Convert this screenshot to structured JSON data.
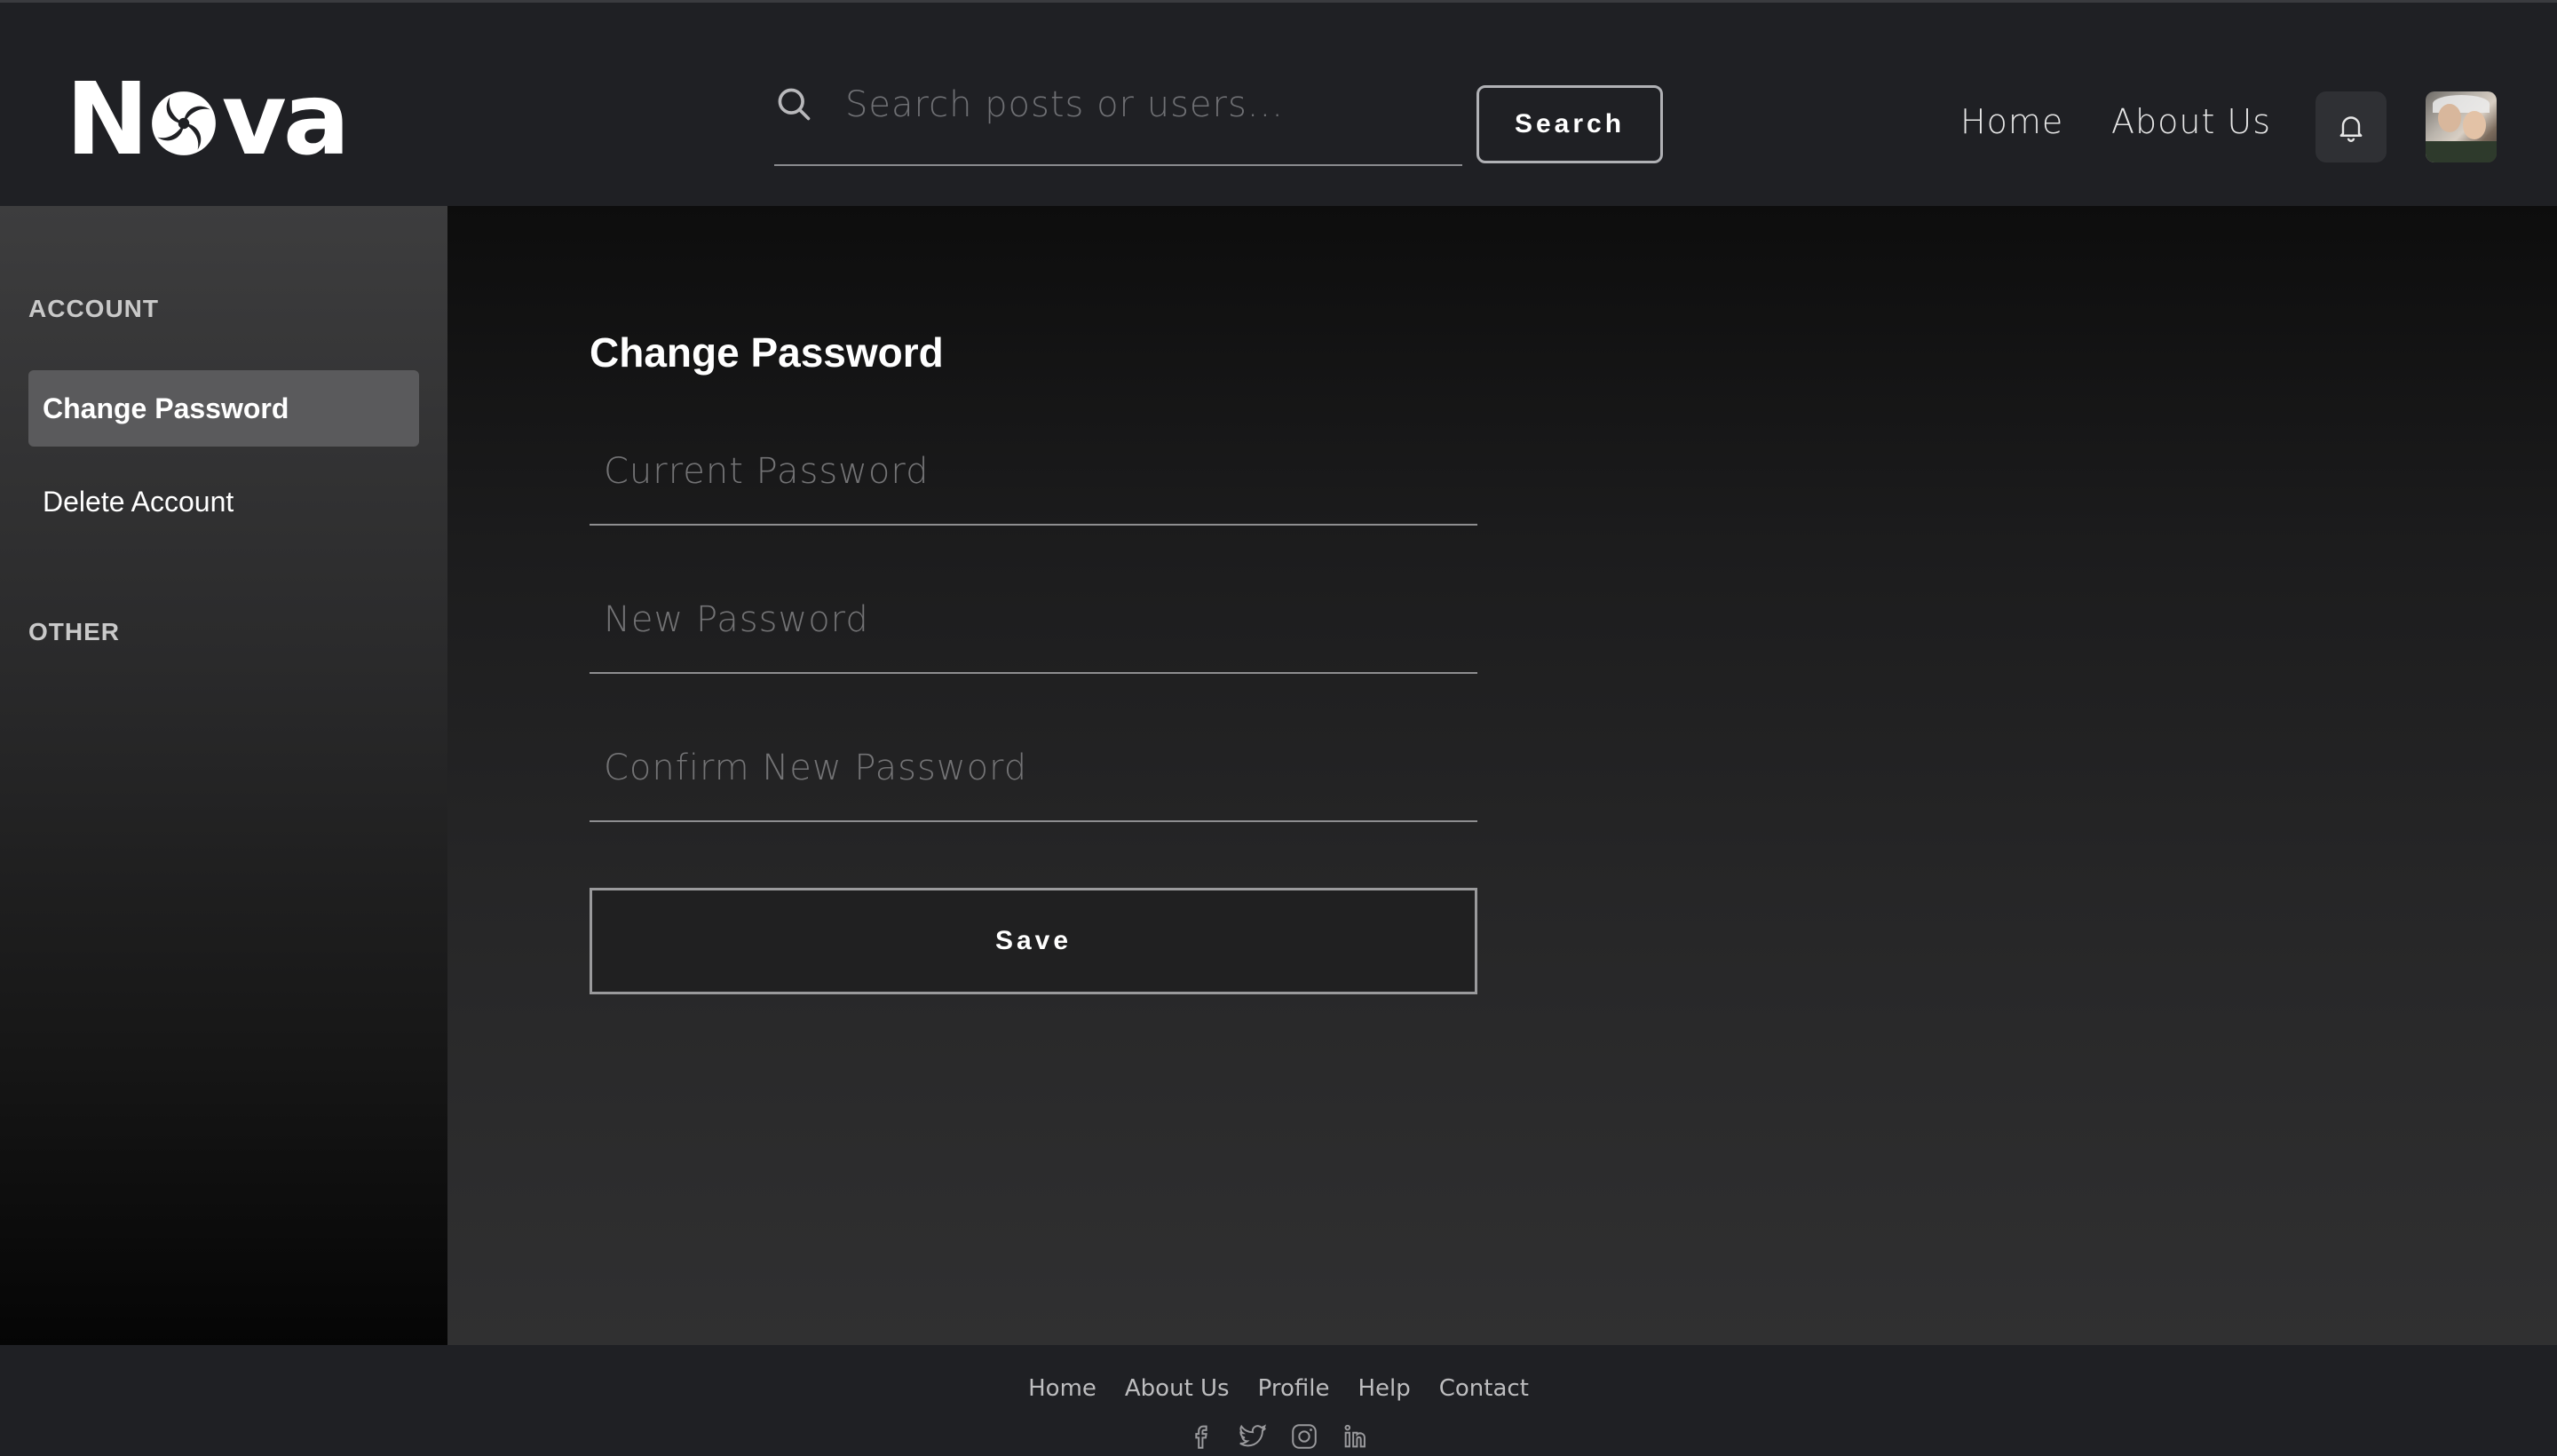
{
  "app": {
    "logo_text_prefix": "N",
    "logo_text_suffix": "va"
  },
  "header": {
    "search": {
      "placeholder": "Search posts or users..."
    },
    "search_button_label": "Search",
    "nav": {
      "home_label": "Home",
      "about_label": "About Us"
    }
  },
  "sidebar": {
    "sections": [
      {
        "title": "ACCOUNT",
        "items": [
          {
            "label": "Change Password",
            "active": true
          },
          {
            "label": "Delete Account",
            "active": false
          }
        ]
      },
      {
        "title": "OTHER",
        "items": []
      }
    ]
  },
  "main": {
    "title": "Change Password",
    "fields": [
      {
        "placeholder": "Current Password"
      },
      {
        "placeholder": "New Password"
      },
      {
        "placeholder": "Confirm New Password"
      }
    ],
    "save_label": "Save"
  },
  "footer": {
    "links": [
      "Home",
      "About Us",
      "Profile",
      "Help",
      "Contact"
    ],
    "social_icons": [
      "facebook-icon",
      "twitter-icon",
      "instagram-icon",
      "linkedin-icon"
    ]
  },
  "colors": {
    "background": "#1f2024",
    "accent_text": "#ffffff",
    "active_item": "#5a5a5c"
  }
}
